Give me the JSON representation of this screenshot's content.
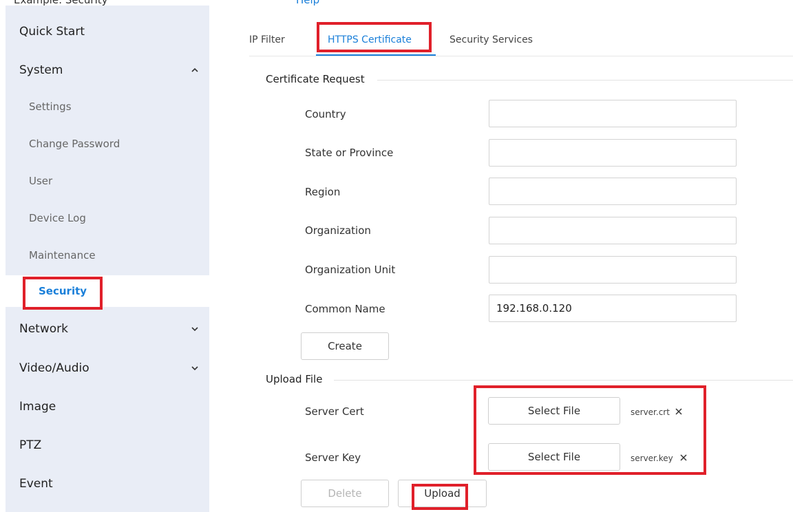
{
  "top_sliver": {
    "left_text": "Example: Security",
    "right_text": "Help"
  },
  "sidebar": {
    "items": [
      {
        "label": "Quick Start"
      },
      {
        "label": "System"
      },
      {
        "label": "Settings"
      },
      {
        "label": "Change Password"
      },
      {
        "label": "User"
      },
      {
        "label": "Device Log"
      },
      {
        "label": "Maintenance"
      },
      {
        "label": "Security"
      },
      {
        "label": "Network"
      },
      {
        "label": "Video/Audio"
      },
      {
        "label": "Image"
      },
      {
        "label": "PTZ"
      },
      {
        "label": "Event"
      }
    ]
  },
  "tabs": [
    {
      "label": "IP Filter"
    },
    {
      "label": "HTTPS Certificate"
    },
    {
      "label": "Security Services"
    }
  ],
  "certificate_request": {
    "title": "Certificate Request",
    "fields": [
      {
        "label": "Country",
        "value": ""
      },
      {
        "label": "State or Province",
        "value": ""
      },
      {
        "label": "Region",
        "value": ""
      },
      {
        "label": "Organization",
        "value": ""
      },
      {
        "label": "Organization Unit",
        "value": ""
      },
      {
        "label": "Common Name",
        "value": "192.168.0.120"
      }
    ],
    "create_label": "Create"
  },
  "upload_file": {
    "title": "Upload File",
    "server_cert": {
      "label": "Server Cert",
      "button": "Select File",
      "filename": "server.crt"
    },
    "server_key": {
      "label": "Server Key",
      "button": "Select File",
      "filename": "server.key"
    },
    "delete_label": "Delete",
    "upload_label": "Upload"
  },
  "colors": {
    "accent": "#1a7fd9",
    "highlight": "#e0202a",
    "sidebar_bg": "#e9edf6"
  },
  "icons": {
    "expand_up": "chevron-up-icon",
    "expand_down": "chevron-down-icon",
    "remove": "close-icon"
  }
}
